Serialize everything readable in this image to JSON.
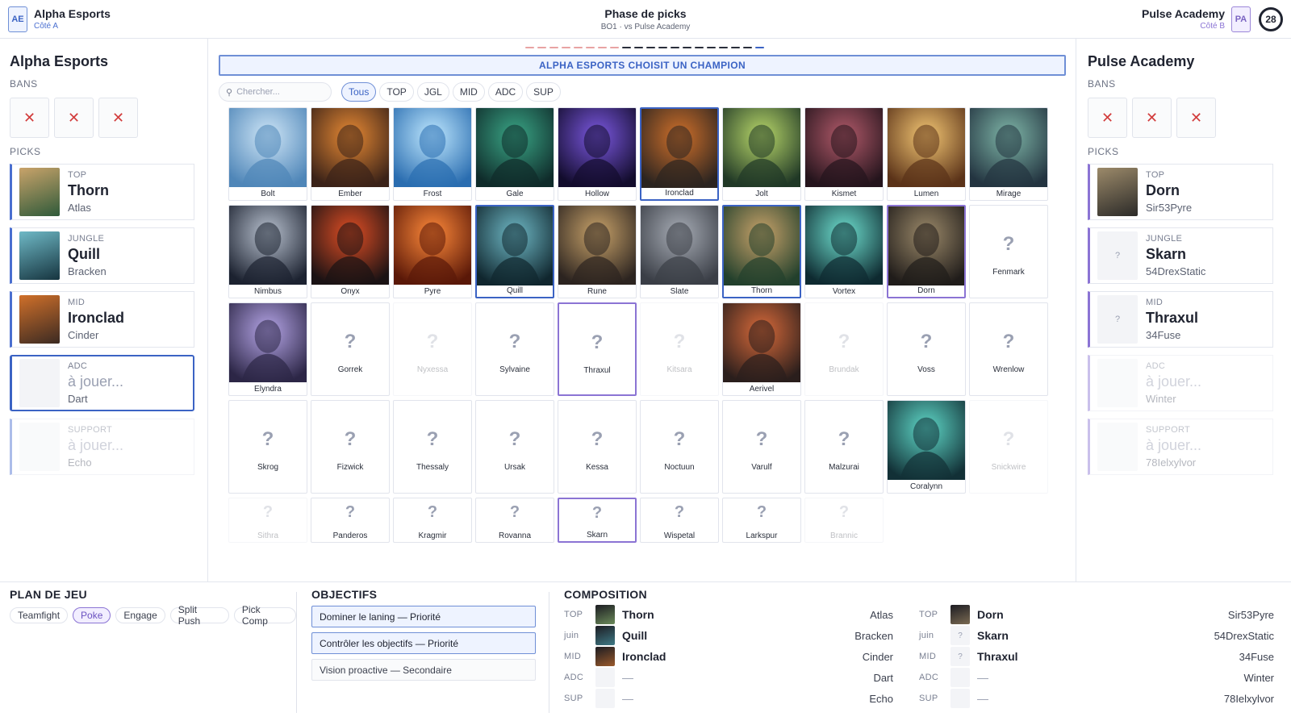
{
  "header": {
    "team_a": {
      "badge": "AE",
      "name": "Alpha Esports",
      "side": "Côté A"
    },
    "team_b": {
      "badge": "PA",
      "name": "Pulse Academy",
      "side": "Côté B"
    },
    "title": "Phase de picks",
    "subtitle": "BO1 · vs Pulse Academy",
    "timer": "28"
  },
  "left_panel": {
    "team_name": "Alpha Esports",
    "bans_label": "BANS",
    "ban_glyph": "✕",
    "picks_label": "PICKS",
    "picks": [
      {
        "role": "TOP",
        "champion": "Thorn",
        "player": "Atlas",
        "state": "locked",
        "art": "gradient:#2f5a3a,#c9a36a"
      },
      {
        "role": "JUNGLE",
        "champion": "Quill",
        "player": "Bracken",
        "state": "locked",
        "art": "gradient:#16343f,#6fb9c6"
      },
      {
        "role": "MID",
        "champion": "Ironclad",
        "player": "Cinder",
        "state": "locked",
        "art": "gradient:#3b2a22,#d0702a"
      },
      {
        "role": "ADC",
        "champion": "à jouer...",
        "player": "Dart",
        "state": "active"
      },
      {
        "role": "SUPPORT",
        "champion": "à jouer...",
        "player": "Echo",
        "state": "pending"
      }
    ]
  },
  "right_panel": {
    "team_name": "Pulse Academy",
    "bans_label": "BANS",
    "ban_glyph": "✕",
    "picks_label": "PICKS",
    "picks": [
      {
        "role": "TOP",
        "champion": "Dorn",
        "player": "Sir53Pyre",
        "state": "locked",
        "art": "gradient:#2b2a28,#9c8a6a"
      },
      {
        "role": "JUNGLE",
        "champion": "Skarn",
        "player": "54DrexStatic",
        "state": "locked-unknown",
        "placeholder": "?"
      },
      {
        "role": "MID",
        "champion": "Thraxul",
        "player": "34Fuse",
        "state": "locked-unknown",
        "placeholder": "?"
      },
      {
        "role": "ADC",
        "champion": "à jouer...",
        "player": "Winter",
        "state": "pending"
      },
      {
        "role": "SUPPORT",
        "champion": "à jouer...",
        "player": "78Ielxylvor",
        "state": "pending"
      }
    ]
  },
  "center": {
    "progress": {
      "total": 20,
      "done": 12,
      "colors": {
        "a": "#e8a3a3",
        "done": "#2a2f3b",
        "current": "#3b63c4"
      }
    },
    "banner": "ALPHA ESPORTS CHOISIT UN CHAMPION",
    "search_placeholder": "Chercher...",
    "search_icon": "magnifier-icon",
    "filters": [
      {
        "label": "Tous",
        "active": true
      },
      {
        "label": "TOP",
        "active": false
      },
      {
        "label": "JGL",
        "active": false
      },
      {
        "label": "MID",
        "active": false
      },
      {
        "label": "ADC",
        "active": false
      },
      {
        "label": "SUP",
        "active": false
      }
    ],
    "champions": [
      {
        "name": "Bolt",
        "art": [
          "#cfe6f7",
          "#4f86b8"
        ]
      },
      {
        "name": "Ember",
        "art": [
          "#e88a34",
          "#3a2218"
        ]
      },
      {
        "name": "Frost",
        "art": [
          "#bfe8ff",
          "#2a6db0"
        ]
      },
      {
        "name": "Gale",
        "art": [
          "#3aa686",
          "#0f2b2a"
        ]
      },
      {
        "name": "Hollow",
        "art": [
          "#7b58e0",
          "#120c2c"
        ]
      },
      {
        "name": "Ironclad",
        "art": [
          "#d0702a",
          "#2b2420"
        ],
        "state": "picked-a"
      },
      {
        "name": "Jolt",
        "art": [
          "#b9d86a",
          "#203826"
        ]
      },
      {
        "name": "Kismet",
        "art": [
          "#b25a6a",
          "#24141c"
        ]
      },
      {
        "name": "Lumen",
        "art": [
          "#f4c774",
          "#5a3218"
        ]
      },
      {
        "name": "Mirage",
        "art": [
          "#7fb6a8",
          "#233440"
        ]
      },
      {
        "name": "Nimbus",
        "art": [
          "#b9c2d0",
          "#1c2230"
        ]
      },
      {
        "name": "Onyx",
        "art": [
          "#e04e24",
          "#1a1214"
        ]
      },
      {
        "name": "Pyre",
        "art": [
          "#ff8a3a",
          "#5a1808"
        ]
      },
      {
        "name": "Quill",
        "art": [
          "#6fb9c6",
          "#10262e"
        ],
        "state": "picked-a"
      },
      {
        "name": "Rune",
        "art": [
          "#c9a36a",
          "#2c2420"
        ]
      },
      {
        "name": "Slate",
        "art": [
          "#a8adb6",
          "#3a3e46"
        ]
      },
      {
        "name": "Thorn",
        "art": [
          "#c9a36a",
          "#22402c"
        ],
        "state": "picked-a"
      },
      {
        "name": "Vortex",
        "art": [
          "#6fe0d0",
          "#0e2a30"
        ]
      },
      {
        "name": "Dorn",
        "art": [
          "#9c8a6a",
          "#201c1a"
        ],
        "state": "picked-b"
      },
      {
        "name": "Fenmark",
        "unknown": true
      },
      {
        "name": "Elyndra",
        "art": [
          "#b6a6e8",
          "#2c2646"
        ]
      },
      {
        "name": "Gorrek",
        "unknown": true
      },
      {
        "name": "Nyxessa",
        "unknown": true,
        "state": "disabled"
      },
      {
        "name": "Sylvaine",
        "unknown": true
      },
      {
        "name": "Thraxul",
        "unknown": true,
        "state": "picked-b"
      },
      {
        "name": "Kitsara",
        "unknown": true,
        "state": "disabled"
      },
      {
        "name": "Aerivel",
        "art": [
          "#d86a3a",
          "#2a1e1c"
        ]
      },
      {
        "name": "Brundak",
        "unknown": true,
        "state": "disabled"
      },
      {
        "name": "Voss",
        "unknown": true
      },
      {
        "name": "Wrenlow",
        "unknown": true
      },
      {
        "name": "Skrog",
        "unknown": true
      },
      {
        "name": "Fizwick",
        "unknown": true
      },
      {
        "name": "Thessaly",
        "unknown": true
      },
      {
        "name": "Ursak",
        "unknown": true
      },
      {
        "name": "Kessa",
        "unknown": true
      },
      {
        "name": "Noctuun",
        "unknown": true
      },
      {
        "name": "Varulf",
        "unknown": true
      },
      {
        "name": "Malzurai",
        "unknown": true
      },
      {
        "name": "Coralynn",
        "art": [
          "#5fd8c8",
          "#123036"
        ]
      },
      {
        "name": "Snickwire",
        "unknown": true,
        "state": "disabled"
      },
      {
        "name": "Sithra",
        "unknown": true,
        "state": "disabled"
      },
      {
        "name": "Panderos",
        "unknown": true
      },
      {
        "name": "Kragmir",
        "unknown": true
      },
      {
        "name": "Rovanna",
        "unknown": true
      },
      {
        "name": "Skarn",
        "unknown": true,
        "state": "picked-b"
      },
      {
        "name": "Wispetal",
        "unknown": true
      },
      {
        "name": "Larkspur",
        "unknown": true
      },
      {
        "name": "Brannic",
        "unknown": true,
        "state": "disabled"
      }
    ],
    "unknown_glyph": "?"
  },
  "plan": {
    "title": "PLAN DE JEU",
    "tags": [
      {
        "label": "Teamfight",
        "active": false
      },
      {
        "label": "Poke",
        "active": true
      },
      {
        "label": "Engage",
        "active": false
      },
      {
        "label": "Split Push",
        "active": false
      },
      {
        "label": "Pick Comp",
        "active": false
      }
    ]
  },
  "objectives": {
    "title": "OBJECTIFS",
    "items": [
      {
        "label": "Dominer le laning — Priorité",
        "highlighted": true
      },
      {
        "label": "Contrôler les objectifs — Priorité",
        "highlighted": true
      },
      {
        "label": "Vision proactive — Secondaire",
        "highlighted": false
      }
    ]
  },
  "composition": {
    "title": "COMPOSITION",
    "rows": [
      {
        "role_a": "TOP",
        "champ_a": "Thorn",
        "player_a": "Atlas",
        "icon_a": "#6b8a5a",
        "role_b": "TOP",
        "champ_b": "Dorn",
        "player_b": "Sir53Pyre",
        "icon_b": "#7a6a52"
      },
      {
        "role_a": "juin",
        "champ_a": "Quill",
        "player_a": "Bracken",
        "icon_a": "#3f7a86",
        "role_b": "juin",
        "champ_b": "Skarn",
        "player_b": "54DrexStatic",
        "icon_b": "?"
      },
      {
        "role_a": "MID",
        "champ_a": "Ironclad",
        "player_a": "Cinder",
        "icon_a": "#9a5a2c",
        "role_b": "MID",
        "champ_b": "Thraxul",
        "player_b": "34Fuse",
        "icon_b": "?"
      },
      {
        "role_a": "ADC",
        "champ_a": "—",
        "player_a": "Dart",
        "icon_a": "",
        "role_b": "ADC",
        "champ_b": "—",
        "player_b": "Winter",
        "icon_b": ""
      },
      {
        "role_a": "SUP",
        "champ_a": "—",
        "player_a": "Echo",
        "icon_a": "",
        "role_b": "SUP",
        "champ_b": "—",
        "player_b": "78Ielxylvor",
        "icon_b": ""
      }
    ]
  }
}
